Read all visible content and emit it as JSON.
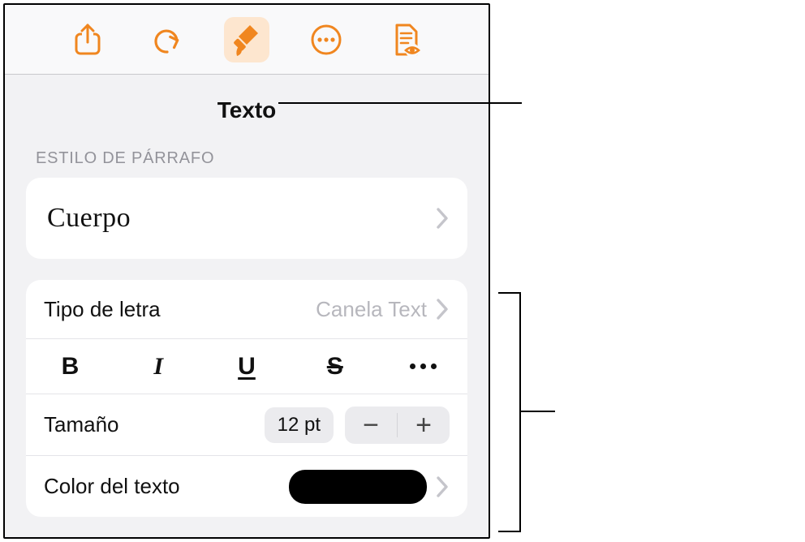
{
  "toolbar": {
    "share": "share-icon",
    "undo": "undo-icon",
    "format": "paintbrush-icon",
    "more": "more-icon",
    "view": "document-view-icon"
  },
  "section": {
    "title": "Texto"
  },
  "paragraphStyle": {
    "header": "ESTILO DE PÁRRAFO",
    "value": "Cuerpo"
  },
  "font": {
    "label": "Tipo de letra",
    "value": "Canela Text"
  },
  "format": {
    "bold": "B",
    "italic": "I",
    "underline": "U",
    "strike": "S"
  },
  "size": {
    "label": "Tamaño",
    "value": "12 pt",
    "minus": "−",
    "plus": "+"
  },
  "color": {
    "label": "Color del texto",
    "value": "#000000"
  }
}
